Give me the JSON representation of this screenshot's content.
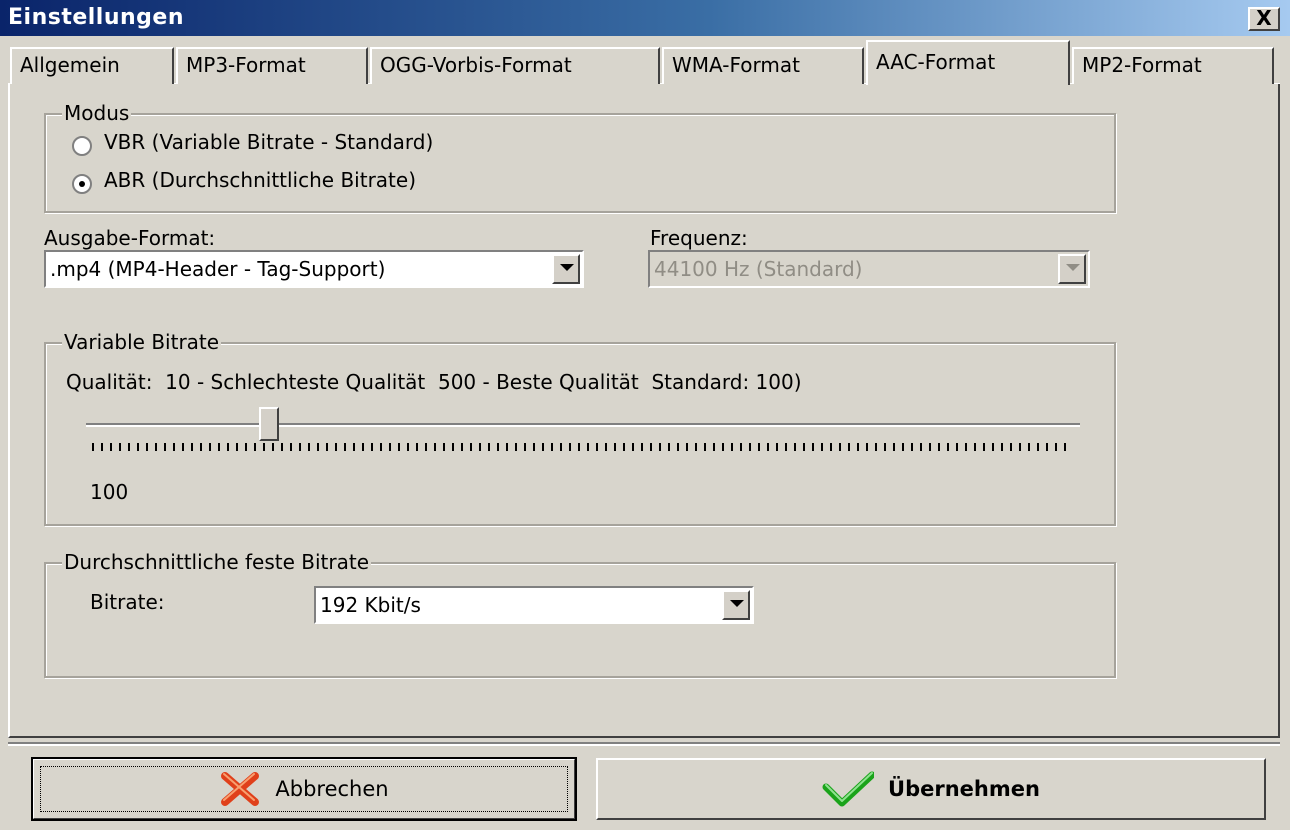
{
  "window": {
    "title": "Einstellungen",
    "close_label": "X"
  },
  "tabs": [
    {
      "label": "Allgemein"
    },
    {
      "label": "MP3-Format"
    },
    {
      "label": "OGG-Vorbis-Format"
    },
    {
      "label": "WMA-Format"
    },
    {
      "label": "AAC-Format",
      "active": true
    },
    {
      "label": "MP2-Format"
    }
  ],
  "modus": {
    "legend": "Modus",
    "options": [
      {
        "label": "VBR (Variable Bitrate - Standard)",
        "selected": false
      },
      {
        "label": "ABR (Durchschnittliche Bitrate)",
        "selected": true
      }
    ]
  },
  "ausgabe": {
    "label": "Ausgabe-Format:",
    "value": ".mp4 (MP4-Header - Tag-Support)"
  },
  "frequenz": {
    "label": "Frequenz:",
    "value": "44100 Hz (Standard)",
    "disabled": true
  },
  "vbr": {
    "legend": "Variable Bitrate",
    "description": "Qualität:  10 - Schlechteste Qualität  500 - Beste Qualität  Standard: 100)",
    "min": 10,
    "max": 500,
    "value": 100,
    "value_label": "100"
  },
  "abr": {
    "legend": "Durchschnittliche feste Bitrate",
    "label": "Bitrate:",
    "value": "192 Kbit/s"
  },
  "buttons": {
    "cancel": {
      "label": "Abbrechen",
      "icon": "red-x-icon"
    },
    "apply": {
      "label": "Übernehmen",
      "icon": "green-check-icon"
    }
  },
  "colors": {
    "title_start": "#0a246a",
    "title_end": "#a6caf0",
    "face": "#d8d5cc",
    "cancel_icon": "#e0401a",
    "apply_icon": "#1aa31a"
  }
}
